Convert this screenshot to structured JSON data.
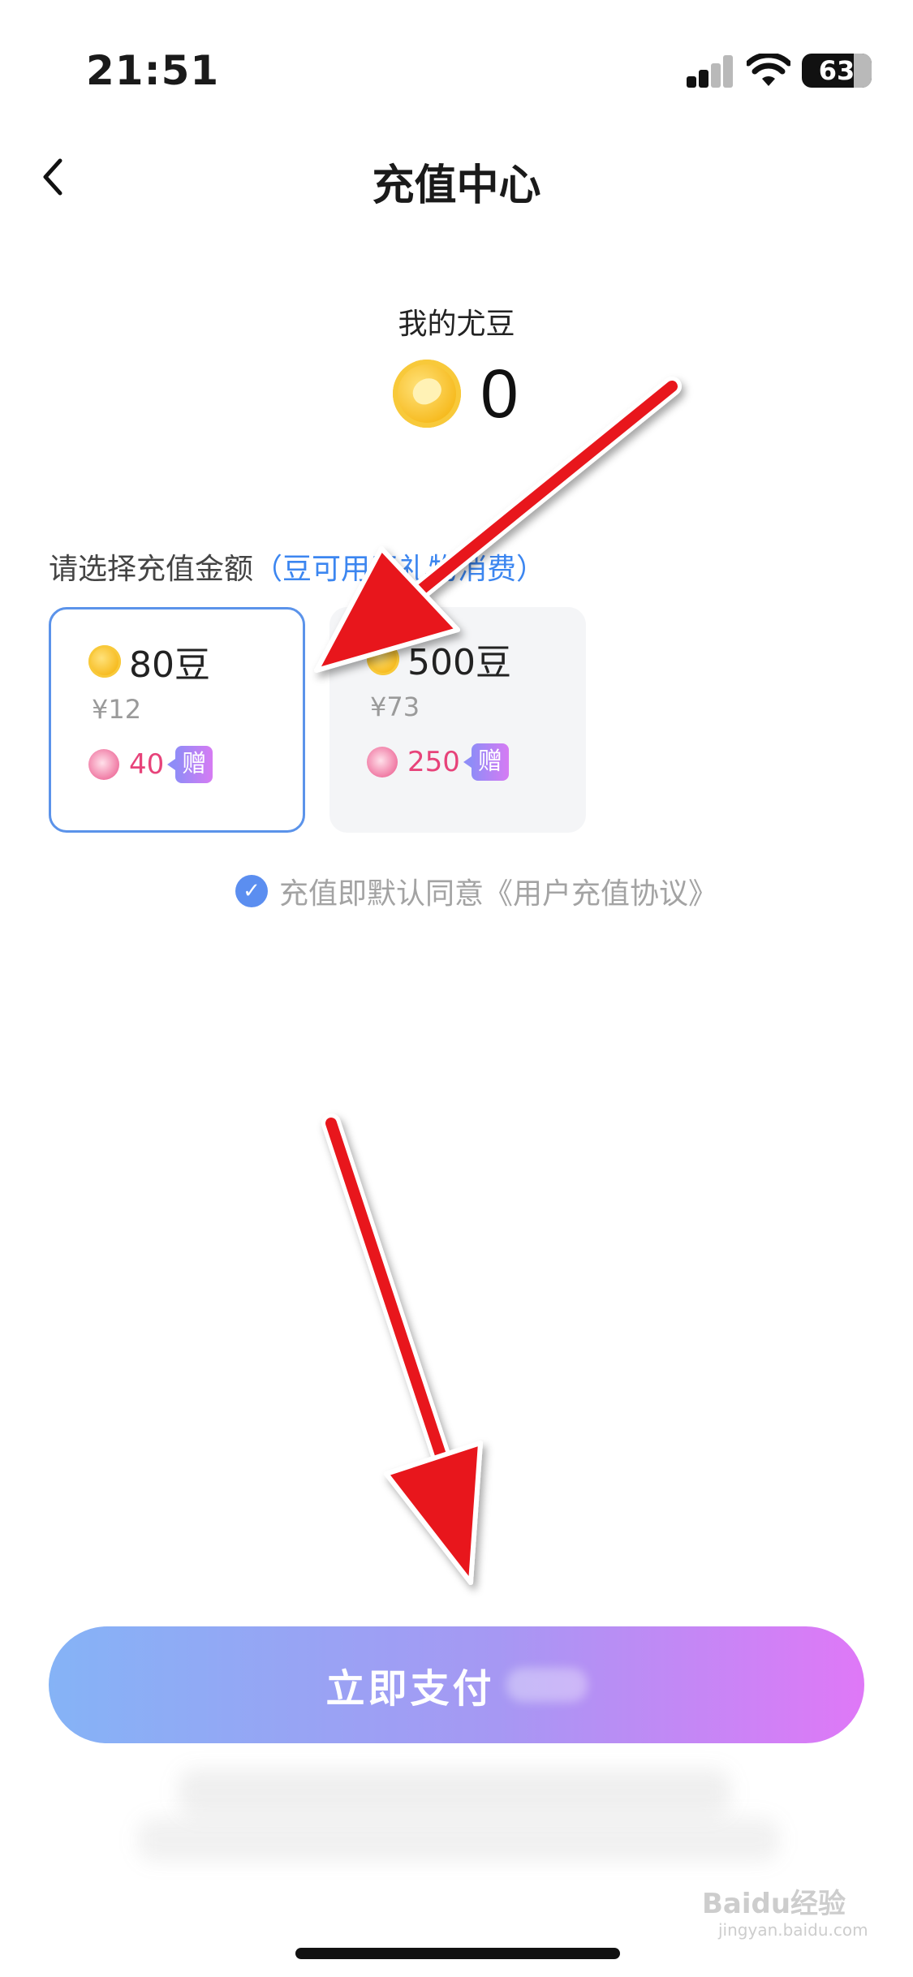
{
  "status_bar": {
    "time": "21:51",
    "battery": "63"
  },
  "nav": {
    "title": "充值中心"
  },
  "balance": {
    "label": "我的尤豆",
    "value": "0"
  },
  "prompt": {
    "text": "请选择充值金额",
    "hint": "（豆可用于礼物消费）"
  },
  "packages": [
    {
      "amount": "80豆",
      "price": "¥12",
      "bonus": "40",
      "tag": "赠",
      "selected": true
    },
    {
      "amount": "500豆",
      "price": "¥73",
      "bonus": "250",
      "tag": "赠",
      "selected": false
    }
  ],
  "agreement": {
    "text": "充值即默认同意《用户充值协议》",
    "checked": true
  },
  "pay_button": {
    "label": "立即支付"
  },
  "watermark": {
    "brand": "Baidu经验",
    "url": "jingyan.baidu.com"
  },
  "colors": {
    "accent": "#5b93ea",
    "bonus": "#e7437a",
    "annotation_arrow": "#e8141c"
  }
}
